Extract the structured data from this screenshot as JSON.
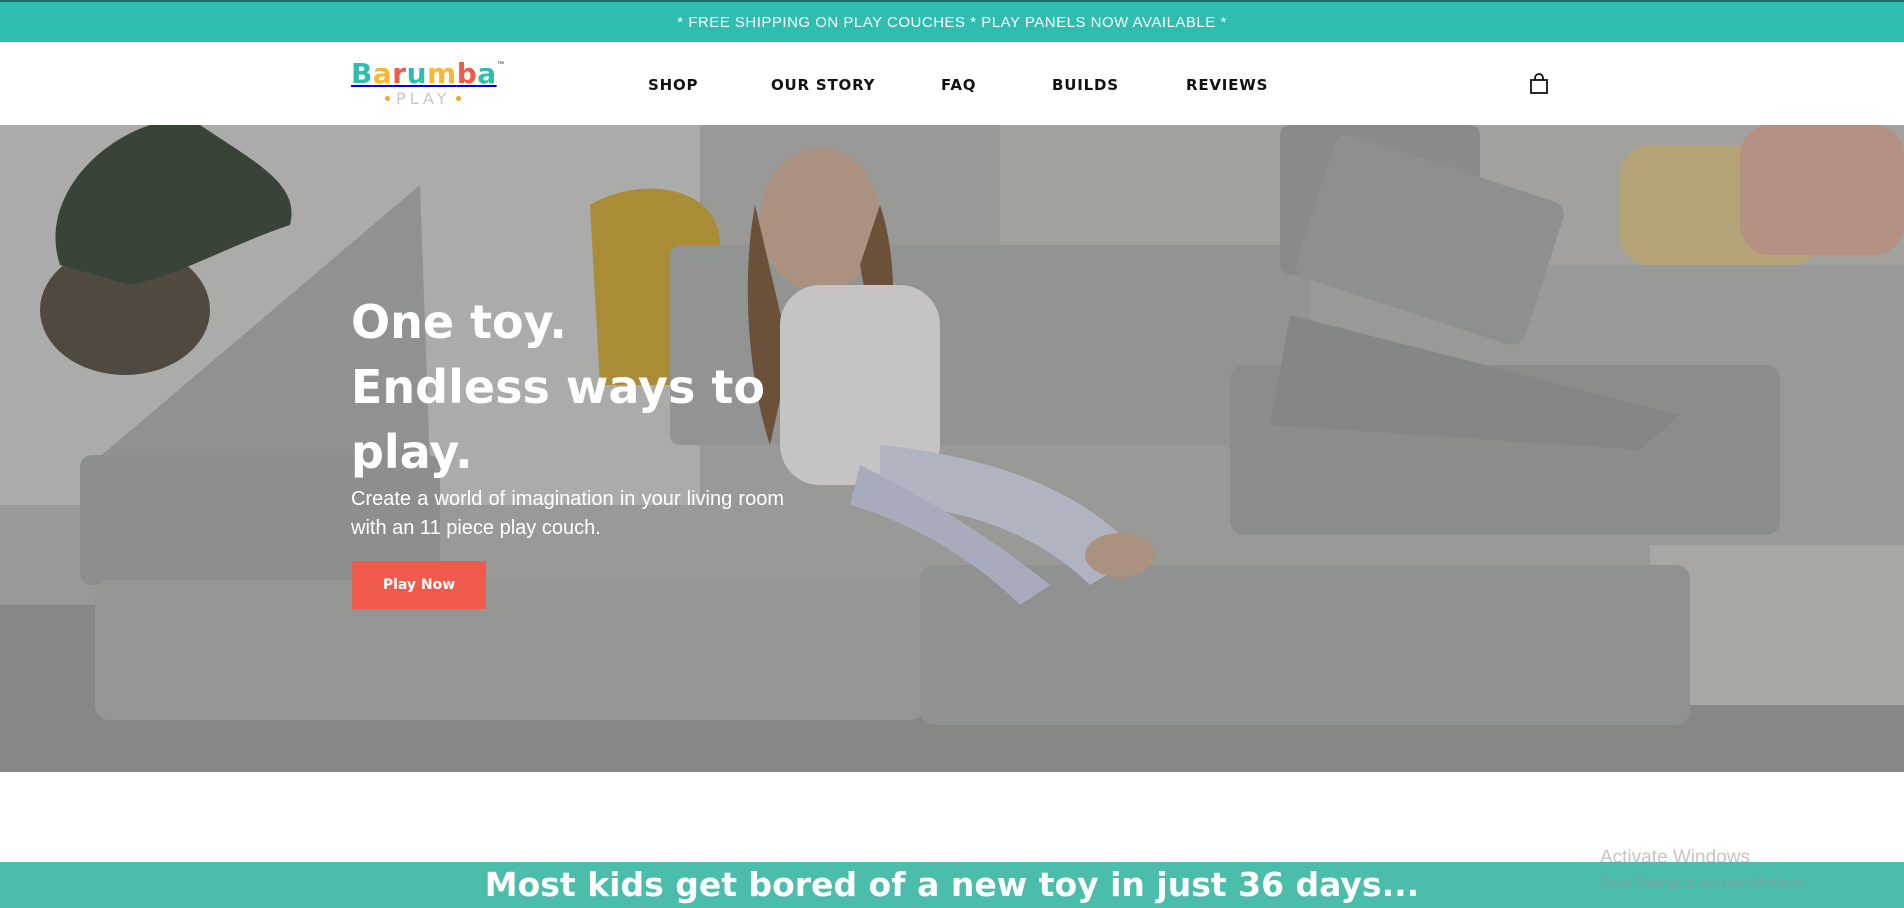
{
  "announcement": "* FREE SHIPPING ON PLAY COUCHES * PLAY PANELS NOW AVAILABLE *",
  "logo": {
    "letters": [
      {
        "ch": "B",
        "color": "#2fbdaf"
      },
      {
        "ch": "a",
        "color": "#f7b733"
      },
      {
        "ch": "r",
        "color": "#ef5a4c"
      },
      {
        "ch": "u",
        "color": "#2fbdaf"
      },
      {
        "ch": "m",
        "color": "#f7b733"
      },
      {
        "ch": "b",
        "color": "#ef5a4c"
      },
      {
        "ch": "a",
        "color": "#2fbdaf"
      }
    ],
    "trademark": "™",
    "sub": "PLAY"
  },
  "nav": {
    "shop": "SHOP",
    "our_story": "OUR STORY",
    "faq": "FAQ",
    "builds": "BUILDS",
    "reviews": "REVIEWS"
  },
  "hero": {
    "title_line1": "One toy.",
    "title_line2": "Endless ways to",
    "title_line3": "play.",
    "subtitle": "Create a world of imagination in your living room with an 11 piece play couch.",
    "cta": "Play Now"
  },
  "banner": "Most kids get bored of a new toy in just 36 days...",
  "watermark": {
    "line1": "Activate Windows",
    "line2": "Go to Settings to activate Windows."
  },
  "colors": {
    "teal": "#2fbdaf",
    "coral": "#ef5a4c",
    "banner_teal": "#4bbdab"
  },
  "icons": {
    "cart": "shopping-bag-icon"
  }
}
